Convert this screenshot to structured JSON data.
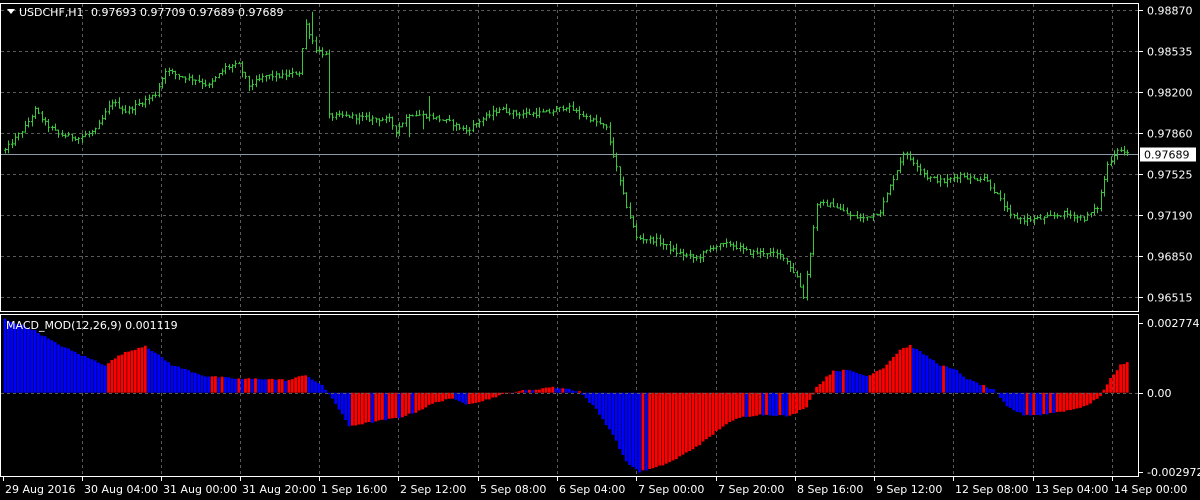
{
  "header": {
    "symbol": "USDCHF,H1",
    "ohlc": "0.97693 0.97709 0.97689 0.97689"
  },
  "indicator": {
    "label": "MACD_MOD(12,26,9) 0.001119"
  },
  "colors": {
    "background": "#000000",
    "grid": "#5a5a5a",
    "frame": "#ffffff",
    "bars": "#3cc63c",
    "bid_line": "#8c9aa8",
    "macd_positive_falling": "#0000ff",
    "macd_rising": "#ff0000"
  },
  "chart_data": [
    {
      "type": "ohlc",
      "title": "USDCHF,H1",
      "grid": true,
      "y_ticks": [
        "0.98870",
        "0.98535",
        "0.98200",
        "0.97860",
        "0.97525",
        "0.97190",
        "0.96850",
        "0.96515"
      ],
      "ylim": [
        0.964,
        0.9892
      ],
      "current_price": "0.97689",
      "x_ticks": [
        "29 Aug 2016",
        "30 Aug 04:00",
        "31 Aug 00:00",
        "31 Aug 20:00",
        "1 Sep 16:00",
        "2 Sep 12:00",
        "5 Sep 08:00",
        "6 Sep 04:00",
        "7 Sep 00:00",
        "7 Sep 20:00",
        "8 Sep 16:00",
        "9 Sep 12:00",
        "12 Sep 08:00",
        "13 Sep 04:00",
        "14 Sep 00:00"
      ],
      "close_path": [
        [
          0,
          0.9772
        ],
        [
          6,
          0.9791
        ],
        [
          9,
          0.9805
        ],
        [
          12,
          0.9794
        ],
        [
          16,
          0.9785
        ],
        [
          22,
          0.9782
        ],
        [
          27,
          0.9788
        ],
        [
          32,
          0.9812
        ],
        [
          36,
          0.9804
        ],
        [
          40,
          0.981
        ],
        [
          45,
          0.9818
        ],
        [
          48,
          0.9838
        ],
        [
          52,
          0.9833
        ],
        [
          57,
          0.983
        ],
        [
          61,
          0.9825
        ],
        [
          66,
          0.984
        ],
        [
          70,
          0.9842
        ],
        [
          73,
          0.9825
        ],
        [
          78,
          0.9833
        ],
        [
          83,
          0.9833
        ],
        [
          88,
          0.9836
        ],
        [
          90,
          0.9875
        ],
        [
          93,
          0.9855
        ],
        [
          96,
          0.985
        ],
        [
          97,
          0.98
        ],
        [
          103,
          0.98
        ],
        [
          109,
          0.9798
        ],
        [
          115,
          0.9797
        ],
        [
          117,
          0.9788
        ],
        [
          121,
          0.9802
        ],
        [
          127,
          0.98
        ],
        [
          133,
          0.9795
        ],
        [
          138,
          0.9788
        ],
        [
          142,
          0.9796
        ],
        [
          148,
          0.9806
        ],
        [
          153,
          0.9802
        ],
        [
          158,
          0.9802
        ],
        [
          163,
          0.9803
        ],
        [
          168,
          0.9808
        ],
        [
          172,
          0.9802
        ],
        [
          177,
          0.9795
        ],
        [
          180,
          0.979
        ],
        [
          185,
          0.9735
        ],
        [
          189,
          0.97
        ],
        [
          195,
          0.9698
        ],
        [
          201,
          0.9688
        ],
        [
          207,
          0.9683
        ],
        [
          212,
          0.9693
        ],
        [
          217,
          0.9695
        ],
        [
          223,
          0.9688
        ],
        [
          228,
          0.9688
        ],
        [
          233,
          0.9685
        ],
        [
          237,
          0.9668
        ],
        [
          239,
          0.9652
        ],
        [
          241,
          0.9688
        ],
        [
          243,
          0.9728
        ],
        [
          248,
          0.9727
        ],
        [
          253,
          0.9718
        ],
        [
          257,
          0.9716
        ],
        [
          262,
          0.9722
        ],
        [
          267,
          0.9756
        ],
        [
          269,
          0.977
        ],
        [
          273,
          0.976
        ],
        [
          276,
          0.975
        ],
        [
          281,
          0.9746
        ],
        [
          286,
          0.9752
        ],
        [
          290,
          0.9748
        ],
        [
          293,
          0.975
        ],
        [
          297,
          0.9735
        ],
        [
          301,
          0.9718
        ],
        [
          305,
          0.9715
        ],
        [
          311,
          0.9716
        ],
        [
          317,
          0.972
        ],
        [
          323,
          0.9716
        ],
        [
          327,
          0.9725
        ],
        [
          330,
          0.976
        ],
        [
          333,
          0.9773
        ],
        [
          336,
          0.9769
        ]
      ]
    },
    {
      "type": "histogram",
      "title": "MACD_MOD(12,26,9)",
      "last_value": 0.001119,
      "y_ticks": [
        "0.002774",
        "0.00",
        "-0.002972"
      ],
      "ylim": [
        -0.003,
        0.0028
      ],
      "path": [
        [
          0,
          0.00265
        ],
        [
          8,
          0.0023
        ],
        [
          15,
          0.0018
        ],
        [
          22,
          0.0014
        ],
        [
          30,
          0.001
        ],
        [
          35,
          0.0014
        ],
        [
          42,
          0.0017
        ],
        [
          50,
          0.001
        ],
        [
          60,
          0.0006
        ],
        [
          70,
          0.0005
        ],
        [
          78,
          0.0005
        ],
        [
          85,
          0.00045
        ],
        [
          90,
          0.00065
        ],
        [
          95,
          0.00025
        ],
        [
          98,
          -0.0002
        ],
        [
          103,
          -0.0012
        ],
        [
          108,
          -0.0011
        ],
        [
          113,
          -0.001
        ],
        [
          118,
          -0.0009
        ],
        [
          123,
          -0.0007
        ],
        [
          128,
          -0.0004
        ],
        [
          133,
          -0.0002
        ],
        [
          138,
          -0.0004
        ],
        [
          143,
          -0.0003
        ],
        [
          148,
          -0.0001
        ],
        [
          153,
          5e-05
        ],
        [
          158,
          0.0001
        ],
        [
          163,
          0.0002
        ],
        [
          168,
          0.00015
        ],
        [
          172,
          5e-05
        ],
        [
          177,
          -0.0006
        ],
        [
          182,
          -0.0015
        ],
        [
          186,
          -0.0025
        ],
        [
          190,
          -0.00285
        ],
        [
          195,
          -0.0027
        ],
        [
          200,
          -0.00245
        ],
        [
          205,
          -0.0021
        ],
        [
          210,
          -0.0017
        ],
        [
          215,
          -0.0012
        ],
        [
          220,
          -0.0009
        ],
        [
          225,
          -0.0008
        ],
        [
          230,
          -0.0008
        ],
        [
          235,
          -0.00085
        ],
        [
          240,
          -0.0005
        ],
        [
          243,
          0.0002
        ],
        [
          248,
          0.0008
        ],
        [
          253,
          0.0008
        ],
        [
          258,
          0.0006
        ],
        [
          263,
          0.0009
        ],
        [
          268,
          0.00155
        ],
        [
          271,
          0.0017
        ],
        [
          275,
          0.0014
        ],
        [
          280,
          0.001
        ],
        [
          285,
          0.0008
        ],
        [
          288,
          0.0005
        ],
        [
          292,
          0.0003
        ],
        [
          296,
          0.0001
        ],
        [
          300,
          -0.0005
        ],
        [
          305,
          -0.0008
        ],
        [
          310,
          -0.0008
        ],
        [
          315,
          -0.0007
        ],
        [
          320,
          -0.0006
        ],
        [
          325,
          -0.0004
        ],
        [
          328,
          -0.0001
        ],
        [
          331,
          0.0005
        ],
        [
          334,
          0.001
        ],
        [
          336,
          0.00112
        ]
      ]
    }
  ]
}
